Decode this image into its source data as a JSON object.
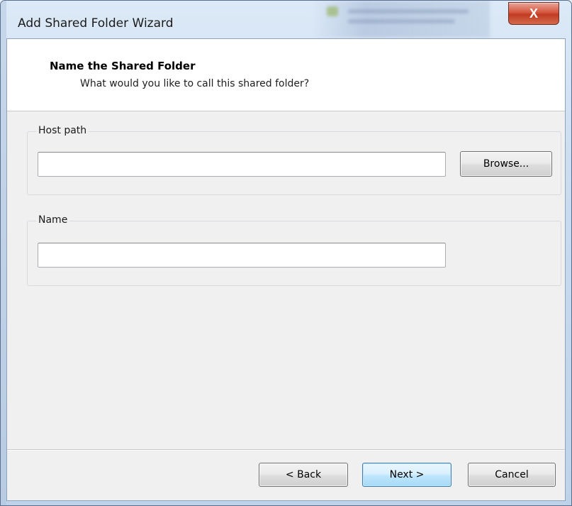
{
  "window": {
    "title": "Add Shared Folder Wizard",
    "close_glyph": "X"
  },
  "header": {
    "title": "Name the Shared Folder",
    "subtitle": "What would you like to call this shared folder?"
  },
  "host_path": {
    "label": "Host path",
    "value": "",
    "browse_label": "Browse..."
  },
  "name": {
    "label": "Name",
    "value": ""
  },
  "footer": {
    "back_label": "< Back",
    "next_label": "Next >",
    "cancel_label": "Cancel"
  },
  "colors": {
    "accent": "#3c7fb1",
    "close": "#c13b22"
  }
}
